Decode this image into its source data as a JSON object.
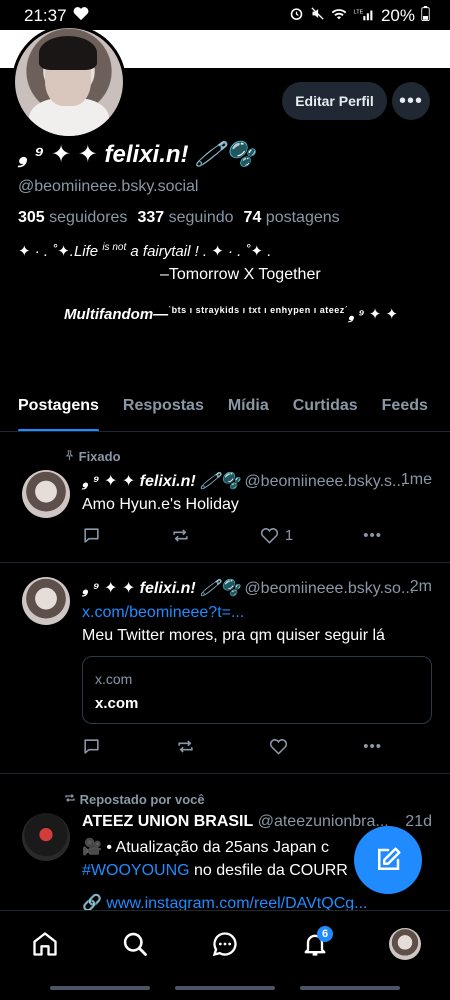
{
  "status_bar": {
    "time": "21:37",
    "battery": "20%"
  },
  "profile": {
    "display_name": "❟ ⁹ ✦ ✦ felixi.n! 🧷🫧",
    "handle": "@beomiineee.bsky.social",
    "stats": {
      "followers": "305",
      "followers_label": "seguidores",
      "following": "337",
      "following_label": "seguindo",
      "posts": "74",
      "posts_label": "postagens"
    },
    "bio_line1_a": "✦ · . ˚✦.Life",
    "bio_line1_b": "is not",
    "bio_line1_c": "a fairytail ! . ✦ · . ˚✦ .",
    "bio_line2": "–Tomorrow X Together",
    "bio_line3_a": "Multifandom—",
    "bio_line3_b": "ˋbts ı straykids ı txt ı enhypen ı ateezˊ",
    "bio_line3_c": "❟ ⁹ ✦ ✦"
  },
  "actions": {
    "edit_profile": "Editar Perfil"
  },
  "tabs": [
    "Postagens",
    "Respostas",
    "Mídia",
    "Curtidas",
    "Feeds",
    "F"
  ],
  "posts": [
    {
      "label": "Fixado",
      "name": "❟ ⁹ ✦ ✦ felixi.n! 🧷🫧",
      "handle": "@beomiineee.bsky.s...",
      "time": "1me",
      "text": "Amo Hyun.e's Holiday",
      "likes": "1"
    },
    {
      "name": "❟ ⁹ ✦ ✦ felixi.n! 🧷🫧",
      "handle": "@beomiineee.bsky.so...",
      "time": "2m",
      "link": "x.com/beomineee?t=...",
      "text": "Meu Twitter mores, pra qm quiser seguir lá",
      "embed_domain": "x.com",
      "embed_title": "x.com"
    },
    {
      "label": "Repostado por você",
      "name": "ATEEZ UNION BRASIL",
      "handle": "@ateezunionbra...",
      "time": "21d",
      "line1": "🎥 • Atualização da 25ans Japan c",
      "line2_tag": "#WOOYOUNG",
      "line2_rest": " no desfile da COURR",
      "line3": "🔗 www.instagram.com/reel/DAVtQCg..."
    }
  ],
  "nav": {
    "notifications_badge": "6"
  },
  "colors": {
    "accent": "#208bfe",
    "muted": "#8a97a6",
    "button_bg": "#1f2833"
  }
}
